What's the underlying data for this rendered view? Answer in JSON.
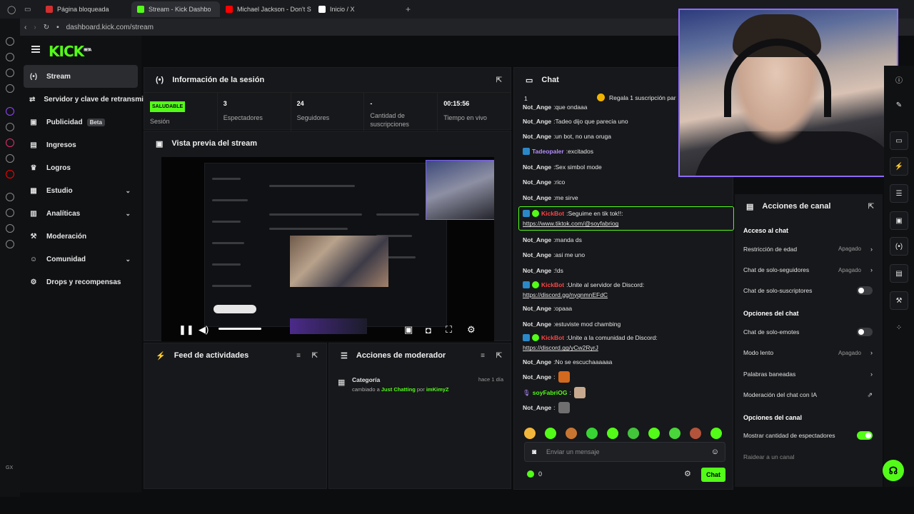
{
  "browser": {
    "tabs": [
      {
        "label": "Página bloqueada",
        "active": false,
        "color": "#d32f2f"
      },
      {
        "label": "Stream - Kick Dashbo",
        "active": true,
        "color": "#53fc18"
      },
      {
        "label": "Michael Jackson - Don't S",
        "active": false,
        "color": "#ff0000"
      },
      {
        "label": "Inicio / X",
        "active": false,
        "color": "#ffffff"
      }
    ],
    "new_tab": "+",
    "url": "dashboard.kick.com/stream"
  },
  "brand": {
    "logo": "KICK",
    "logo_sup": "BETA",
    "accent": "#53fc18"
  },
  "nav": [
    {
      "label": "Stream",
      "icon": "(•)",
      "active": true
    },
    {
      "label": "Servidor y clave de retransmis",
      "icon": "⇄"
    },
    {
      "label": "Publicidad",
      "icon": "▣",
      "badge": "Beta"
    },
    {
      "label": "Ingresos",
      "icon": "▤"
    },
    {
      "label": "Logros",
      "icon": "♛"
    },
    {
      "label": "Estudio",
      "icon": "▦",
      "chevron": "⌄"
    },
    {
      "label": "Analíticas",
      "icon": "▥",
      "chevron": "⌄"
    },
    {
      "label": "Moderación",
      "icon": "⚒"
    },
    {
      "label": "Comunidad",
      "icon": "☺",
      "chevron": "⌄"
    },
    {
      "label": "Drops y recompensas",
      "icon": "⚙"
    }
  ],
  "session": {
    "title": "Información de la sesión",
    "health": "SALUDABLE",
    "health_label": "Sesión",
    "stats": [
      {
        "value": "3",
        "label": "Espectadores"
      },
      {
        "value": "24",
        "label": "Seguidores"
      },
      {
        "value": "-",
        "label": "Cantidad de suscripciones"
      },
      {
        "value": "00:15:56",
        "label": "Tiempo en vivo"
      }
    ]
  },
  "preview": {
    "title": "Vista previa del stream"
  },
  "activity": {
    "title": "Feed de actividades"
  },
  "modactions": {
    "title": "Acciones de moderador",
    "item_title": "Categoría",
    "item_time": "hace 1 día",
    "item_pre": "cambiado a",
    "item_cat": "Just Chatting",
    "item_mid": "por",
    "item_user": "imKimyZ"
  },
  "chat": {
    "title": "Chat",
    "gift_count": "1",
    "gift_text": "Regala 1 suscripción par",
    "messages": [
      {
        "user": "Not_Ange",
        "color": "#e6e6e6",
        "text": "que ondaaa"
      },
      {
        "user": "Not_Ange",
        "color": "#e6e6e6",
        "text": "Tadeo dijo que parecia uno"
      },
      {
        "user": "Not_Ange",
        "color": "#e6e6e6",
        "text": "un bot, no una oruga"
      },
      {
        "user": "Tadeopaler",
        "color": "#b38cff",
        "text": "excitados",
        "badge": "bot"
      },
      {
        "user": "Not_Ange",
        "color": "#e6e6e6",
        "text": "Sex simbol mode"
      },
      {
        "user": "Not_Ange",
        "color": "#e6e6e6",
        "text": "rico"
      },
      {
        "user": "Not_Ange",
        "color": "#e6e6e6",
        "text": "me sirve"
      }
    ],
    "boxed": {
      "user": "KickBot",
      "color": "#ff4444",
      "text": "Seguime en tik tok!!:",
      "link": "https://www.tiktok.com/@soyfabriog"
    },
    "messages2": [
      {
        "user": "Not_Ange",
        "color": "#e6e6e6",
        "text": "manda ds"
      },
      {
        "user": "Not_Ange",
        "color": "#e6e6e6",
        "text": "asi me uno"
      },
      {
        "user": "Not_Ange",
        "color": "#e6e6e6",
        "text": "!ds"
      }
    ],
    "discord1": {
      "user": "KickBot",
      "color": "#ff4444",
      "text": "Unite al servidor de Discord:",
      "link": "https://discord.gg/nyqnmnEFdC"
    },
    "messages3": [
      {
        "user": "Not_Ange",
        "color": "#e6e6e6",
        "text": "opaaa"
      },
      {
        "user": "Not_Ange",
        "color": "#e6e6e6",
        "text": "estuviste mod chambing"
      }
    ],
    "discord2": {
      "user": "KickBot",
      "color": "#ff4444",
      "text": "Unite a la comunidad de Discord:",
      "link": "https://discord.gg/yCw2RyrJ"
    },
    "messages4": [
      {
        "user": "Not_Ange",
        "color": "#e6e6e6",
        "text": "No se escuchaaaaaa"
      },
      {
        "user": "Not_Ange",
        "color": "#e6e6e6",
        "text": ""
      },
      {
        "user": "soyFabriOG",
        "color": "#53fc18",
        "text": ""
      },
      {
        "user": "Not_Ange",
        "color": "#e6e6e6",
        "text": ""
      }
    ],
    "input_placeholder": "Enviar un mensaje",
    "points": "0",
    "send_label": "Chat"
  },
  "actions": {
    "title": "Acciones de canal",
    "sections": [
      {
        "title": "Acceso al chat",
        "rows": [
          {
            "label": "Restricción de edad",
            "value": "Apagado",
            "type": "chevron"
          },
          {
            "label": "Chat de solo-seguidores",
            "value": "Apagado",
            "type": "chevron"
          },
          {
            "label": "Chat de solo-suscriptores",
            "type": "toggle",
            "on": false
          }
        ]
      },
      {
        "title": "Opciones del chat",
        "rows": [
          {
            "label": "Chat de solo-emotes",
            "type": "toggle",
            "on": false
          },
          {
            "label": "Modo lento",
            "value": "Apagado",
            "type": "chevron"
          },
          {
            "label": "Palabras baneadas",
            "type": "chevron"
          },
          {
            "label": "Moderación del chat con IA",
            "type": "external"
          }
        ]
      },
      {
        "title": "Opciones del canal",
        "rows": [
          {
            "label": "Mostrar cantidad de espectadores",
            "type": "toggle",
            "on": true
          },
          {
            "label": "Raidear a un canal",
            "type": "none"
          }
        ]
      }
    ]
  },
  "corner_label": "GX"
}
